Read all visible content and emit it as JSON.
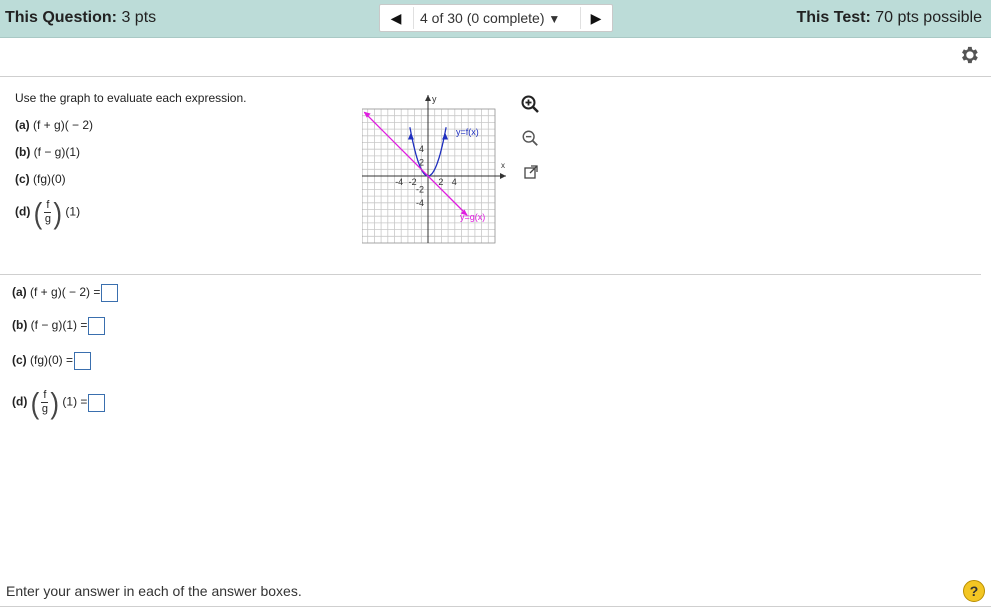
{
  "header": {
    "question_label": "This Question:",
    "question_pts": "3 pts",
    "nav_select": "4 of 30 (0 complete)",
    "test_label": "This Test:",
    "test_pts": "70 pts possible"
  },
  "question": {
    "prompt": "Use the graph to evaluate each expression.",
    "items": [
      {
        "label": "(a)",
        "expr": "(f + g)( − 2)"
      },
      {
        "label": "(b)",
        "expr": "(f − g)(1)"
      },
      {
        "label": "(c)",
        "expr": "(fg)(0)"
      },
      {
        "label": "(d)",
        "num": "f",
        "den": "g",
        "arg": "(1)"
      }
    ]
  },
  "graph": {
    "y_axis_label": "y",
    "x_axis_label": "x",
    "f_label": "y=f(x)",
    "g_label": "y=g(x)",
    "x_ticks": [
      "-4",
      "-2",
      "2",
      "4"
    ],
    "y_ticks": [
      "4",
      "2",
      "-2",
      "-4"
    ],
    "f_color": "#1f2fbf",
    "g_color": "#e01de0"
  },
  "answers": [
    {
      "label": "(a)",
      "expr": "(f + g)( − 2) ="
    },
    {
      "label": "(b)",
      "expr": "(f − g)(1) ="
    },
    {
      "label": "(c)",
      "expr": "(fg)(0) ="
    },
    {
      "label": "(d)",
      "num": "f",
      "den": "g",
      "arg": "(1) ="
    }
  ],
  "footer": {
    "instruction": "Enter your answer in each of the answer boxes.",
    "help": "?"
  }
}
